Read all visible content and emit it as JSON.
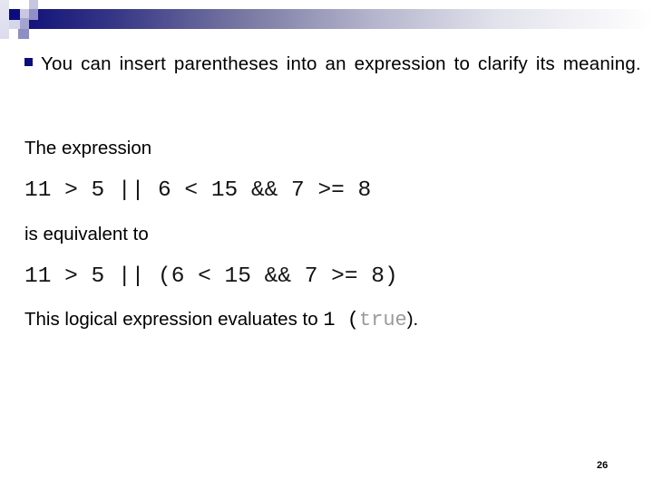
{
  "slide": {
    "bullet": "You can insert parentheses into an expression to clarify its meaning.",
    "intro_label": "The expression",
    "expression_original": "11 > 5 || 6 < 15 && 7 >= 8",
    "equivalence_label": "is equivalent to",
    "expression_parenthesized": "11 > 5 || (6 < 15 && 7 >= 8)",
    "result": {
      "prefix": "This logical expression evaluates to ",
      "value": "1",
      "open_paren": " (",
      "keyword": "true",
      "suffix": ")."
    },
    "page_number": "26"
  },
  "theme": {
    "accent": "#0c0c7c",
    "keyword_color": "#9a9a9a"
  }
}
